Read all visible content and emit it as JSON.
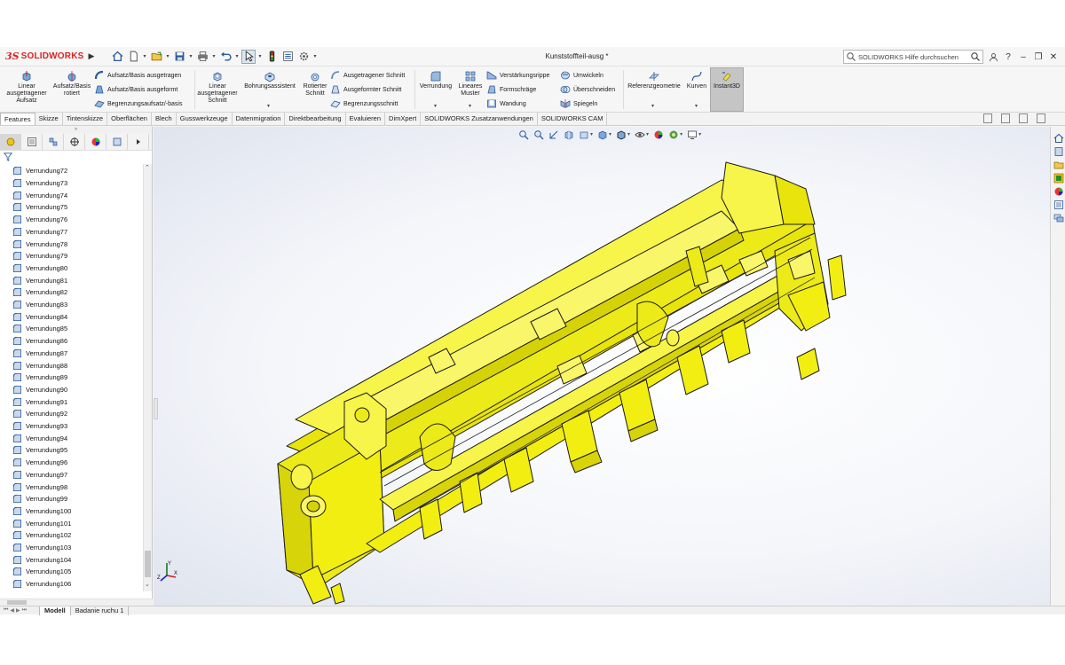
{
  "app": {
    "brand_prefix": "3S",
    "brand_name": "SOLIDWORKS",
    "document_title": "Kunststoffteil-ausg *",
    "search_placeholder": "SOLIDWORKS Hilfe durchsuchen"
  },
  "window_controls": {
    "help": "?",
    "minimize": "–",
    "restore": "❐",
    "close": "✕"
  },
  "command_manager": {
    "linear_boss": "Linear ausgetragener Aufsatz",
    "revolved_boss": "Aufsatz/Basis rotiert",
    "swept_boss": "Aufsatz/Basis ausgetragen",
    "lofted_boss": "Aufsatz/Basis ausgeformt",
    "boundary_boss": "Begrenzungsaufsatz/-basis",
    "linear_cut": "Linear ausgetragener Schnitt",
    "hole_wizard": "Bohrungsassistent",
    "revolved_cut": "Rotierter Schnitt",
    "swept_cut": "Ausgetragener Schnitt",
    "lofted_cut": "Ausgeformter Schnitt",
    "boundary_cut": "Begrenzungsschnitt",
    "fillet": "Verrundung",
    "linear_pattern": "Lineares Muster",
    "rib": "Verstärkungsrippe",
    "draft": "Formschräge",
    "shell": "Wandung",
    "wrap": "Umwickeln",
    "intersect": "Überschneiden",
    "mirror": "Spiegeln",
    "ref_geometry": "Referenzgeometrie",
    "curves": "Kurven",
    "instant3d": "Instant3D"
  },
  "tabs": [
    "Features",
    "Skizze",
    "Tintenskizze",
    "Oberflächen",
    "Blech",
    "Gusswerkzeuge",
    "Datenmigration",
    "Direktbearbeitung",
    "Evaluieren",
    "DimXpert",
    "SOLIDWORKS Zusatzanwendungen",
    "SOLIDWORKS CAM"
  ],
  "feature_tree": {
    "panel_handle": "»",
    "items": [
      "Verrundung72",
      "Verrundung73",
      "Verrundung74",
      "Verrundung75",
      "Verrundung76",
      "Verrundung77",
      "Verrundung78",
      "Verrundung79",
      "Verrundung80",
      "Verrundung81",
      "Verrundung82",
      "Verrundung83",
      "Verrundung84",
      "Verrundung85",
      "Verrundung86",
      "Verrundung87",
      "Verrundung88",
      "Verrundung89",
      "Verrundung90",
      "Verrundung91",
      "Verrundung92",
      "Verrundung93",
      "Verrundung94",
      "Verrundung95",
      "Verrundung96",
      "Verrundung97",
      "Verrundung98",
      "Verrundung99",
      "Verrundung100",
      "Verrundung101",
      "Verrundung102",
      "Verrundung103",
      "Verrundung104",
      "Verrundung105",
      "Verrundung106"
    ]
  },
  "triad": {
    "x": "X",
    "y": "Y",
    "z": "Z"
  },
  "bottom_tabs": [
    "Modell",
    "Badanie ruchu 1"
  ],
  "colors": {
    "model_fill": "#f2ee12",
    "model_edge": "#1b1b1b",
    "accent_red": "#dd2222"
  }
}
